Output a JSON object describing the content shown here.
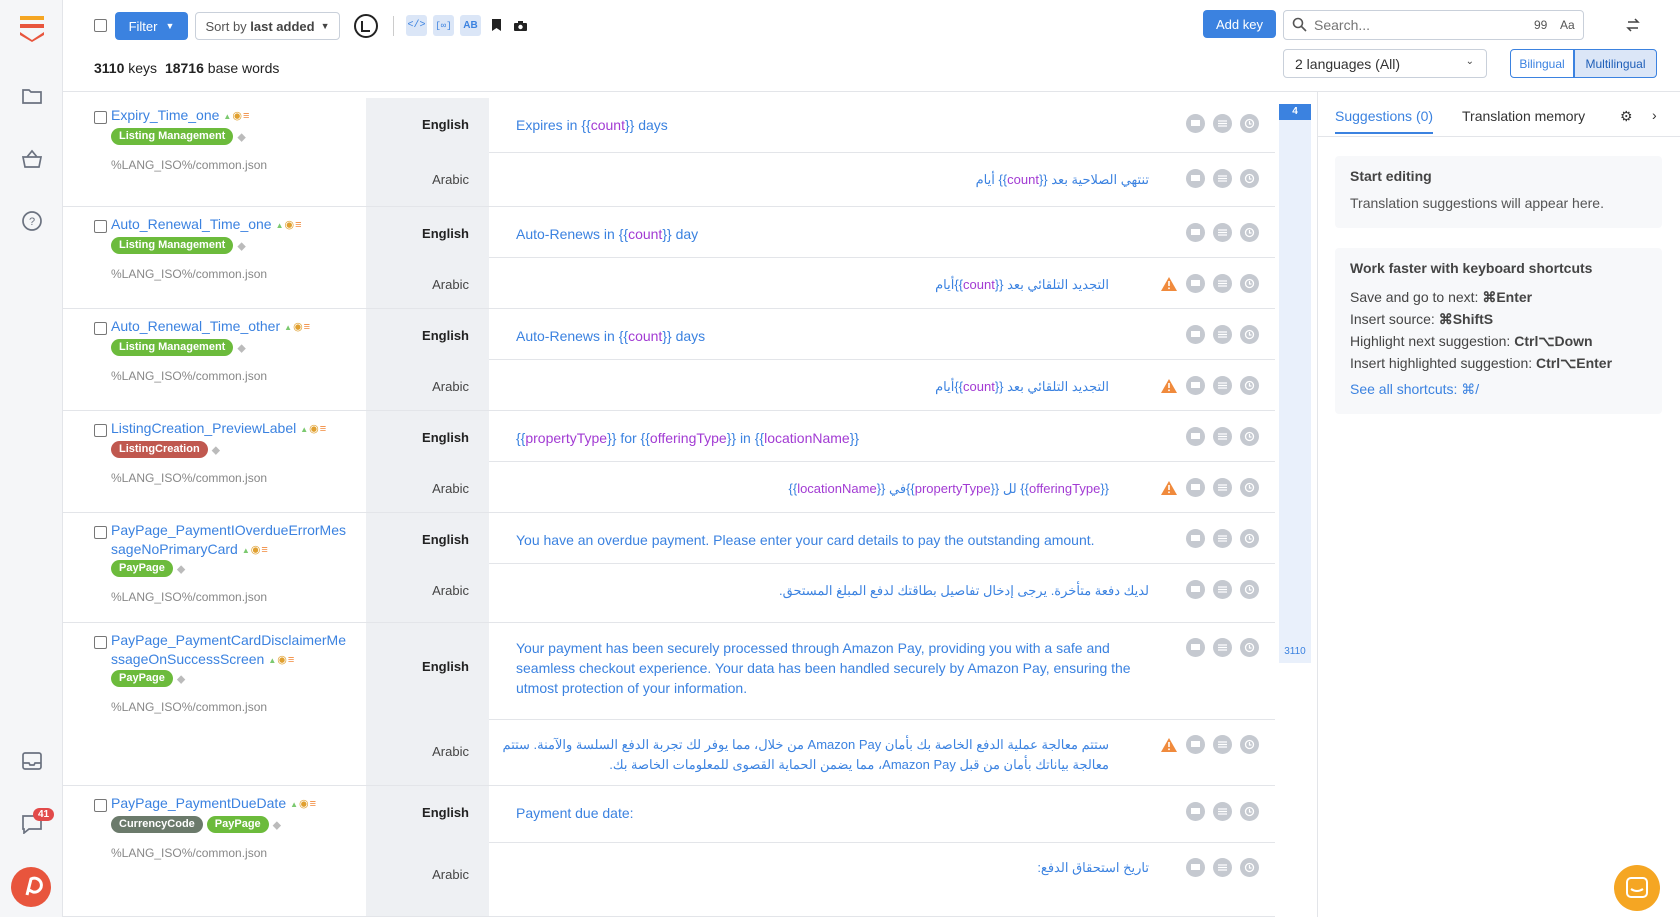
{
  "toolbar": {
    "filter_label": "Filter",
    "sort_prefix": "Sort by ",
    "sort_value": "last added",
    "add_key_label": "Add key",
    "search_placeholder": "Search...",
    "search_badge": "99",
    "case_toggle": "Aa",
    "keys_count": "3110",
    "keys_label": "keys",
    "words_count": "18716",
    "words_label": "base words",
    "languages_select": "2 languages (All)",
    "bilingual_label": "Bilingual",
    "multilingual_label": "Multilingual"
  },
  "rail": {
    "notifications_count": "41"
  },
  "scroll": {
    "top_marker": "4",
    "bottom_marker": "3110"
  },
  "keys": [
    {
      "name": "Expiry_Time_one",
      "tags": [
        {
          "label": "Listing Management",
          "color": "#6cbb3c"
        }
      ],
      "file": "%LANG_ISO%/common.json",
      "en_lang": "English",
      "ar_lang": "Arabic",
      "en": [
        "Expires in ",
        "{{",
        "count",
        "}}",
        " days"
      ],
      "ar_pre": "تنتهي الصلاحية بعد ",
      "ar_ph": "count",
      "ar_post": " أيام",
      "warn": false
    },
    {
      "name": "Auto_Renewal_Time_one",
      "tags": [
        {
          "label": "Listing Management",
          "color": "#6cbb3c"
        }
      ],
      "file": "%LANG_ISO%/common.json",
      "en_lang": "English",
      "ar_lang": "Arabic",
      "en": [
        "Auto-Renews in ",
        "{{",
        "count",
        "}}",
        " day"
      ],
      "ar_pre": "التجديد التلقائي بعد ",
      "ar_ph": "count",
      "ar_post": "أيام",
      "warn": true
    },
    {
      "name": "Auto_Renewal_Time_other",
      "tags": [
        {
          "label": "Listing Management",
          "color": "#6cbb3c"
        }
      ],
      "file": "%LANG_ISO%/common.json",
      "en_lang": "English",
      "ar_lang": "Arabic",
      "en": [
        "Auto-Renews in ",
        "{{",
        "count",
        "}}",
        " days"
      ],
      "ar_pre": "التجديد التلقائي بعد ",
      "ar_ph": "count",
      "ar_post": "أيام",
      "warn": true
    },
    {
      "name": "ListingCreation_PreviewLabel",
      "tags": [
        {
          "label": "ListingCreation",
          "color": "#c0584f"
        }
      ],
      "file": "%LANG_ISO%/common.json",
      "en_lang": "English",
      "ar_lang": "Arabic",
      "en_full": "{{propertyType}} for {{offeringType}} in {{locationName}}",
      "ar_full": "{{offeringType}} لل {{propertyType}}في {{locationName}}",
      "warn": true
    },
    {
      "name": "PayPage_PaymentIOverdueErrorMessageNoPrimaryCard",
      "name_l1": "PayPage_PaymentIOverdueErrorMes",
      "name_l2": "sageNoPrimaryCard",
      "tags": [
        {
          "label": "PayPage",
          "color": "#6cbb3c"
        }
      ],
      "file": "%LANG_ISO%/common.json",
      "en_lang": "English",
      "ar_lang": "Arabic",
      "en_text": "You have an overdue payment. Please enter your card details to pay the outstanding amount.",
      "ar_text": "لديك دفعة متأخرة. يرجى إدخال تفاصيل بطاقتك لدفع المبلغ المستحق.",
      "warn": false
    },
    {
      "name": "PayPage_PaymentCardDisclaimerMessageOnSuccessScreen",
      "name_l1": "PayPage_PaymentCardDisclaimerMe",
      "name_l2": "ssageOnSuccessScreen",
      "tags": [
        {
          "label": "PayPage",
          "color": "#6cbb3c"
        }
      ],
      "file": "%LANG_ISO%/common.json",
      "en_lang": "English",
      "ar_lang": "Arabic",
      "en_text": "Your payment has been securely processed through Amazon Pay, providing you with a safe and seamless checkout experience. Your data has been handled securely by Amazon Pay, ensuring the utmost protection of your information.",
      "ar_text": "ستتم معالجة عملية الدفع الخاصة بك بأمان Amazon Pay من خلال، مما يوفر لك تجربة الدفع السلسة والآمنة. ستتم معالجة بياناتك بأمان من قبل Amazon Pay، مما يضمن الحماية القصوى للمعلومات الخاصة بك.",
      "warn": true
    },
    {
      "name": "PayPage_PaymentDueDate",
      "tags": [
        {
          "label": "CurrencyCode",
          "color": "#6b7a6b"
        },
        {
          "label": "PayPage",
          "color": "#6cbb3c"
        }
      ],
      "file": "%LANG_ISO%/common.json",
      "en_lang": "English",
      "ar_lang": "Arabic",
      "en_text": "Payment due date:",
      "ar_text": "تاريخ استحقاق الدفع:",
      "warn": false
    }
  ],
  "sidebar": {
    "tab_suggestions": "Suggestions (0)",
    "tab_memory": "Translation memory",
    "start_title": "Start editing",
    "start_text": "Translation suggestions will appear here.",
    "shortcuts_title": "Work faster with keyboard shortcuts",
    "shortcuts": [
      {
        "label": "Save and go to next: ",
        "keys": "⌘Enter"
      },
      {
        "label": "Insert source: ",
        "keys": "⌘ShiftS"
      },
      {
        "label": "Highlight next suggestion: ",
        "keys": "Ctrl⌥Down"
      },
      {
        "label": "Insert highlighted suggestion: ",
        "keys": "Ctrl⌥Enter"
      }
    ],
    "see_all": "See all shortcuts: ⌘/"
  },
  "colors": {
    "accent": "#3b82e0",
    "placeholder": "#a23bd3",
    "warning": "#f08a3c"
  }
}
